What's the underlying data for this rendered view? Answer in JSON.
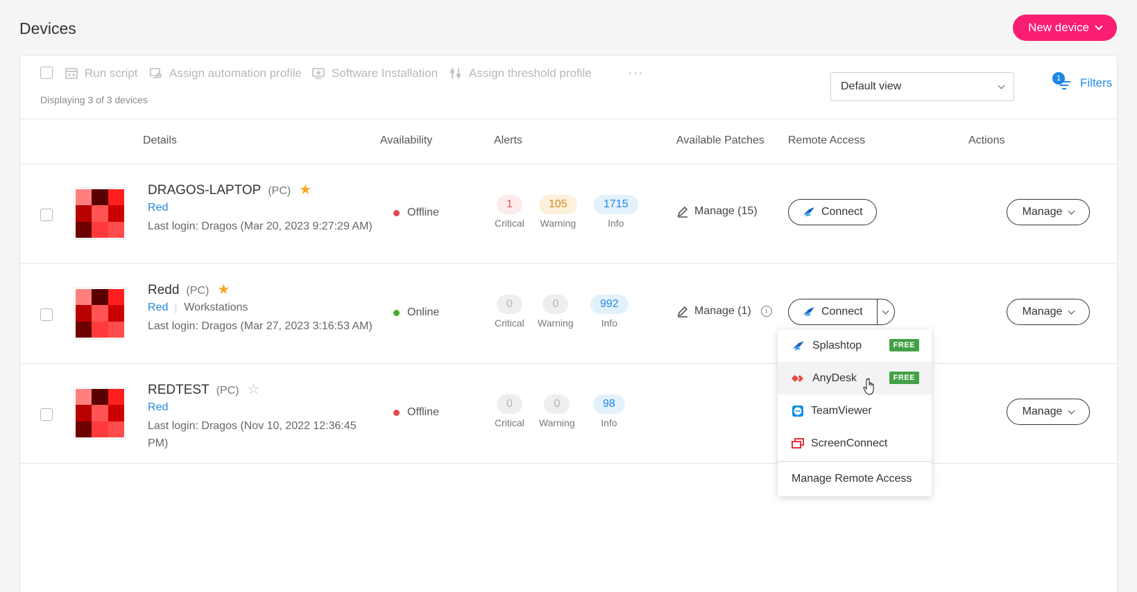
{
  "header": {
    "title": "Devices",
    "new_device_label": "New device"
  },
  "toolbar": {
    "run_script": "Run script",
    "assign_automation": "Assign automation profile",
    "software_installation": "Software Installation",
    "assign_threshold": "Assign threshold profile",
    "more": "···",
    "display_count": "Displaying 3 of 3 devices",
    "view_select": "Default view",
    "filters_label": "Filters",
    "filters_count": "1"
  },
  "columns": {
    "details": "Details",
    "availability": "Availability",
    "alerts": "Alerts",
    "patches": "Available Patches",
    "remote": "Remote Access",
    "actions": "Actions"
  },
  "devices": [
    {
      "name": "DRAGOS-LAPTOP",
      "type": "(PC)",
      "group": "Red",
      "category": "",
      "login": "Last login: Dragos (Mar 20, 2023 9:27:29 AM)",
      "status": "Offline",
      "status_color": "#e5484d",
      "critical": "1",
      "warning": "105",
      "info": "1715",
      "patches": "Manage (15)",
      "connect": "Connect",
      "manage": "Manage"
    },
    {
      "name": "Redd",
      "type": "(PC)",
      "group": "Red",
      "category": "Workstations",
      "login": "Last login: Dragos (Mar 27, 2023 3:16:53 AM)",
      "status": "Online",
      "status_color": "#43b02a",
      "critical": "0",
      "warning": "0",
      "info": "992",
      "patches": "Manage (1)",
      "connect": "Connect",
      "manage": "Manage"
    },
    {
      "name": "REDTEST",
      "type": "(PC)",
      "group": "Red",
      "category": "",
      "login": "Last login: Dragos (Nov 10, 2022 12:36:45 PM)",
      "status": "Offline",
      "status_color": "#e5484d",
      "critical": "0",
      "warning": "0",
      "info": "98",
      "patches": "",
      "connect": "",
      "manage": "Manage"
    }
  ],
  "alert_labels": {
    "critical": "Critical",
    "warning": "Warning",
    "info": "Info"
  },
  "remote_menu": {
    "items": [
      {
        "label": "Splashtop",
        "badge": "FREE",
        "icon": "splashtop-icon"
      },
      {
        "label": "AnyDesk",
        "badge": "FREE",
        "icon": "anydesk-icon"
      },
      {
        "label": "TeamViewer",
        "badge": "",
        "icon": "teamviewer-icon"
      },
      {
        "label": "ScreenConnect",
        "badge": "",
        "icon": "screenconnect-icon"
      }
    ],
    "manage_label": "Manage Remote Access"
  },
  "colors": {
    "accent": "#fa1e73",
    "link": "#1e88e5",
    "free_badge": "#43a047"
  }
}
